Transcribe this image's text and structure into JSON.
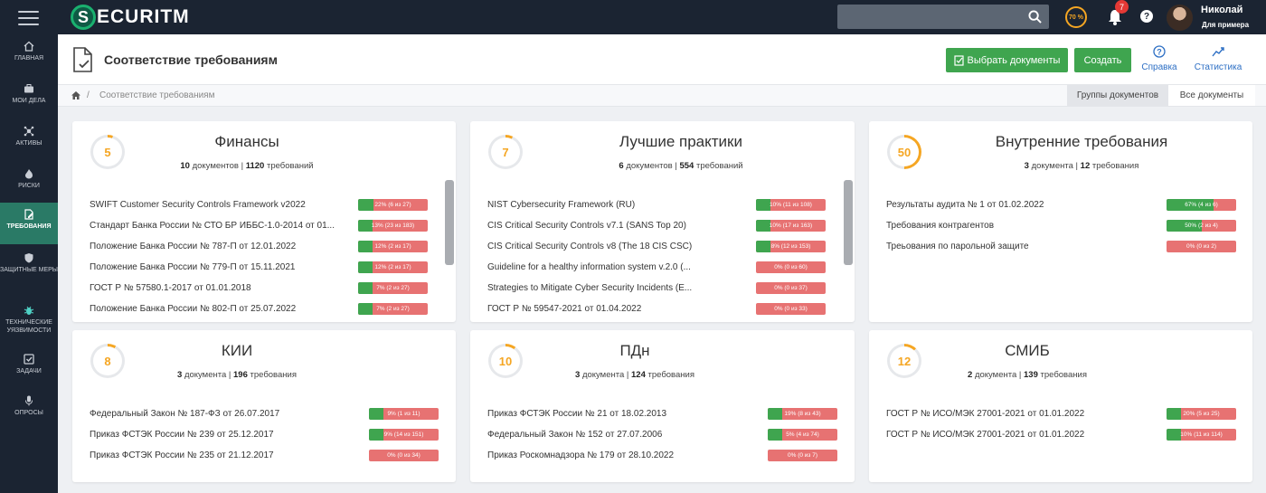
{
  "topbar": {
    "logo_letter": "S",
    "logo_text": "ECURITM",
    "search_placeholder": "",
    "score_label": "70 %",
    "score_percent": 70,
    "notifications_count": "7",
    "help_glyph": "?",
    "user_name": "Николай",
    "user_role": "Для примера",
    "icons": [
      "menu-icon",
      "search-icon",
      "bell-icon",
      "help-icon"
    ]
  },
  "sidebar": {
    "items": [
      {
        "label": "ГЛАВНАЯ",
        "icon": "home-icon",
        "active": false
      },
      {
        "label": "МОИ ДЕЛА",
        "icon": "briefcase-icon",
        "active": false
      },
      {
        "label": "АКТИВЫ",
        "icon": "network-icon",
        "active": false
      },
      {
        "label": "РИСКИ",
        "icon": "fire-icon",
        "active": false
      },
      {
        "label": "ТРЕБОВАНИЯ",
        "icon": "document-edit-icon",
        "active": true
      },
      {
        "label": "ЗАЩИТНЫЕ МЕРЫ",
        "icon": "shield-icon",
        "active": false
      },
      {
        "label": "ТЕХНИЧЕСКИЕ УЯЗВИМОСТИ",
        "icon": "bug-icon",
        "active": false
      },
      {
        "label": "ЗАДАЧИ",
        "icon": "checkbox-icon",
        "active": false
      },
      {
        "label": "ОПРОСЫ",
        "icon": "microphone-icon",
        "active": false
      }
    ]
  },
  "header": {
    "title": "Соответствие требованиям",
    "choose_docs_label": "Выбрать документы",
    "create_label": "Создать",
    "help_label": "Справка",
    "stats_label": "Статистика"
  },
  "breadcrumb": {
    "separator": "/",
    "current": "Соответствие требованиям"
  },
  "view_tabs": {
    "groups": "Группы документов",
    "all": "Все документы",
    "active": "groups"
  },
  "colors": {
    "accent_green": "#3fa54f",
    "bar_red": "#e77272",
    "ring_orange": "#f5a623",
    "dark": "#1b2432"
  },
  "cards": [
    {
      "score": "5",
      "title": "Финансы",
      "docs_count": "10",
      "docs_word": "документов",
      "req_count": "1120",
      "req_word": "требований",
      "rows": [
        {
          "name": "SWIFT Customer Security Controls Framework v2022",
          "pct": 22,
          "label": "22% (6 из 27)"
        },
        {
          "name": "Стандарт Банка России № СТО БР ИББС-1.0-2014 от 01...",
          "pct": 13,
          "label": "13% (23 из 183)"
        },
        {
          "name": "Положение Банка России № 787-П от 12.01.2022",
          "pct": 12,
          "label": "12% (2 из 17)"
        },
        {
          "name": "Положение Банка России № 779-П от 15.11.2021",
          "pct": 12,
          "label": "12% (2 из 17)"
        },
        {
          "name": "ГОСТ Р № 57580.1-2017 от 01.01.2018",
          "pct": 7,
          "label": "7% (2 из 27)"
        },
        {
          "name": "Положение Банка России № 802-П от 25.07.2022",
          "pct": 7,
          "label": "7% (2 из 27)"
        }
      ]
    },
    {
      "score": "7",
      "title": "Лучшие практики",
      "docs_count": "6",
      "docs_word": "документов",
      "req_count": "554",
      "req_word": "требований",
      "rows": [
        {
          "name": "NIST Cybersecurity Framework (RU)",
          "pct": 10,
          "label": "10% (11 из 108)"
        },
        {
          "name": "CIS Critical Security Controls v7.1 (SANS Top 20)",
          "pct": 10,
          "label": "10% (17 из 163)"
        },
        {
          "name": "CIS Critical Security Controls v8 (The 18 CIS CSC)",
          "pct": 8,
          "label": "8% (12 из 153)"
        },
        {
          "name": "Guideline for a healthy information system v.2.0 (...",
          "pct": 0,
          "label": "0% (0 из 60)"
        },
        {
          "name": "Strategies to Mitigate Cyber Security Incidents (E...",
          "pct": 0,
          "label": "0% (0 из 37)"
        },
        {
          "name": "ГОСТ Р № 59547-2021 от 01.04.2022",
          "pct": 0,
          "label": "0% (0 из 33)"
        }
      ]
    },
    {
      "score": "50",
      "title": "Внутренние требования",
      "docs_count": "3",
      "docs_word": "документа",
      "req_count": "12",
      "req_word": "требования",
      "rows": [
        {
          "name": "Результаты аудита № 1 от 01.02.2022",
          "pct": 67,
          "label": "67% (4 из 6)"
        },
        {
          "name": "Требования контрагентов",
          "pct": 50,
          "label": "50% (2 из 4)"
        },
        {
          "name": "Треьования по парольной защите",
          "pct": 0,
          "label": "0% (0 из 2)"
        }
      ]
    },
    {
      "score": "8",
      "title": "КИИ",
      "docs_count": "3",
      "docs_word": "документа",
      "req_count": "196",
      "req_word": "требования",
      "rows": [
        {
          "name": "Федеральный Закон № 187-ФЗ от 26.07.2017",
          "pct": 9,
          "label": "9% (1 из 11)"
        },
        {
          "name": "Приказ ФСТЭК России № 239 от 25.12.2017",
          "pct": 9,
          "label": "9% (14 из 151)"
        },
        {
          "name": "Приказ ФСТЭК России № 235 от 21.12.2017",
          "pct": 0,
          "label": "0% (0 из 34)"
        }
      ]
    },
    {
      "score": "10",
      "title": "ПДн",
      "docs_count": "3",
      "docs_word": "документа",
      "req_count": "124",
      "req_word": "требования",
      "rows": [
        {
          "name": "Приказ ФСТЭК России № 21 от 18.02.2013",
          "pct": 19,
          "label": "19% (8 из 43)"
        },
        {
          "name": "Федеральный Закон № 152 от 27.07.2006",
          "pct": 5,
          "label": "5% (4 из 74)"
        },
        {
          "name": "Приказ Роскомнадзора № 179 от 28.10.2022",
          "pct": 0,
          "label": "0% (0 из 7)"
        }
      ]
    },
    {
      "score": "12",
      "title": "СМИБ",
      "docs_count": "2",
      "docs_word": "документа",
      "req_count": "139",
      "req_word": "требования",
      "rows": [
        {
          "name": "ГОСТ Р № ИСО/МЭК 27001-2021 от 01.01.2022",
          "pct": 20,
          "label": "20% (5 из 25)"
        },
        {
          "name": "ГОСТ Р № ИСО/МЭК 27001-2021 от 01.01.2022",
          "pct": 10,
          "label": "10% (11 из 114)"
        }
      ]
    }
  ]
}
